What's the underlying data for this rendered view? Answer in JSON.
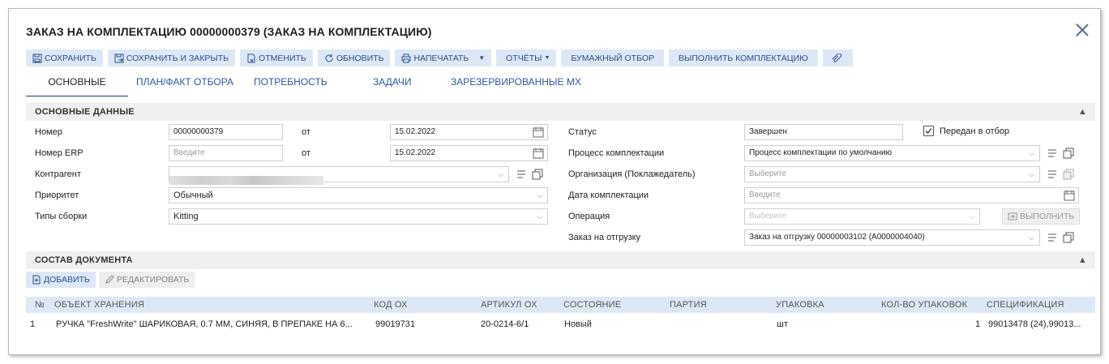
{
  "window": {
    "title": "ЗАКАЗ НА КОМПЛЕКТАЦИЮ 00000000379 (ЗАКАЗ НА КОМПЛЕКТАЦИЮ)"
  },
  "toolbar": {
    "save": "СОХРАНИТЬ",
    "save_close": "СОХРАНИТЬ И ЗАКРЫТЬ",
    "cancel": "ОТМЕНИТЬ",
    "refresh": "ОБНОВИТЬ",
    "print": "НАПЕЧАТАТЬ",
    "reports": "ОТЧЁТЫ",
    "paper": "БУМАЖНЫЙ ОТБОР",
    "complete": "ВЫПОЛНИТЬ КОМПЛЕКТАЦИЮ"
  },
  "tabs": {
    "t0": "ОСНОВНЫЕ",
    "t1": "ПЛАН/ФАКТ ОТБОРА",
    "t2": "ПОТРЕБНОСТЬ",
    "t3": "ЗАДАЧИ",
    "t4": "ЗАРЕЗЕРВИРОВАННЫЕ МХ"
  },
  "main_section": {
    "title": "ОСНОВНЫЕ ДАННЫЕ"
  },
  "form": {
    "number_label": "Номер",
    "number_value": "00000000379",
    "from1": "от",
    "date1": "15.02.2022",
    "erp_label": "Номер ERP",
    "erp_placeholder": "Введите",
    "from2": "от",
    "date2": "15.02.2022",
    "counterparty_label": "Контрагент",
    "priority_label": "Приоритет",
    "priority_value": "Обычный",
    "assembly_label": "Типы сборки",
    "assembly_value": "Kitting",
    "status_label": "Статус",
    "status_value": "Завершен",
    "sent_label": "Передан в отбор",
    "sent_checked": true,
    "process_label": "Процесс комплектации",
    "process_value": "Процесс комплектации по умолчанию",
    "org_label": "Организация (Поклажедатель)",
    "org_placeholder": "Выберите",
    "date_label": "Дата комплектации",
    "date_placeholder": "Введите",
    "operation_label": "Операция",
    "operation_placeholder": "Выберите",
    "execute": "ВЫПОЛНИТЬ",
    "shipment_label": "Заказ на отгрузку",
    "shipment_value": "Заказ на отгрузку 00000003102 (A0000004040)"
  },
  "doc_section": {
    "title": "СОСТАВ ДОКУМЕНТА",
    "add": "ДОБАВИТЬ",
    "edit": "РЕДАКТИРОВАТЬ"
  },
  "table": {
    "headers": {
      "num": "№",
      "object": "ОБЪЕКТ ХРАНЕНИЯ",
      "code": "КОД ОХ",
      "article": "АРТИКУЛ ОХ",
      "state": "СОСТОЯНИЕ",
      "batch": "ПАРТИЯ",
      "pack": "УПАКОВКА",
      "qty": "КОЛ-ВО УПАКОВОК",
      "spec": "СПЕЦИФИКАЦИЯ"
    },
    "rows": [
      {
        "num": "1",
        "object": "РУЧКА \"FreshWrite\" ШАРИКОВАЯ, 0.7 ММ, СИНЯЯ, В ПРЕПАКЕ НА 6...",
        "code": "99019731",
        "article": "20-0214-6/1",
        "state": "Новый",
        "batch": "",
        "pack": "шт",
        "qty": "1",
        "spec": "99013478 (24),99013..."
      }
    ]
  },
  "colors": {
    "accent": "#2a56a4",
    "button_bg": "#dde8f7",
    "header_bg": "#f0f0f0"
  }
}
